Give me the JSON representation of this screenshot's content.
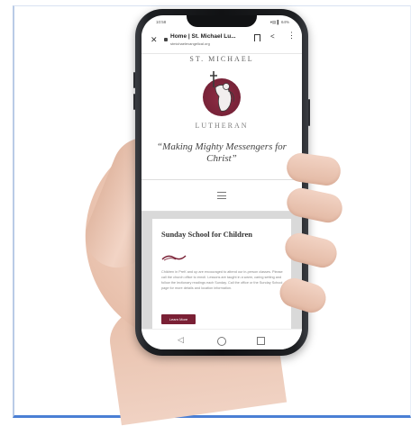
{
  "browser": {
    "time": "10:58",
    "status_icons": "▾▤ ▌ 64%",
    "tab_title": "Home | St. Michael Lu...",
    "url": "stmichaelevangelical.org",
    "close_symbol": "✕",
    "share_symbol": "<",
    "menu_symbol": "⋮"
  },
  "site": {
    "name": "ST. MICHAEL",
    "church": "LUTHERAN",
    "tagline": "“Making Mighty Messengers for Christ”",
    "logo_color": "#7a2035"
  },
  "card": {
    "title": "Sunday School for Children",
    "body": "Children in PreK and up are encouraged to attend our in-person classes. Please call the church office to enroll. Lessons are taught in a warm, caring setting and follow the lectionary readings each Sunday. Call the office or the Sunday School page for more details and location information.",
    "button_label": "Learn More"
  },
  "android_nav": {
    "back": "◁",
    "home": "home",
    "recent": "recent"
  },
  "colors": {
    "accent": "#7a2035",
    "frame_border": "#4a7fd4"
  }
}
